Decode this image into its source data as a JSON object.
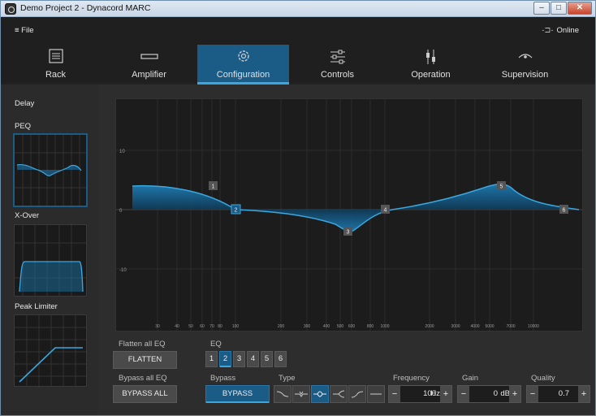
{
  "window": {
    "title": "Demo Project 2 - Dynacord MARC",
    "minimize": "–",
    "maximize": "□",
    "close": "✕"
  },
  "menu": {
    "file": "≡ File",
    "online": "Online"
  },
  "tabs": [
    {
      "label": "Rack",
      "icon": "rack-icon"
    },
    {
      "label": "Amplifier",
      "icon": "amplifier-icon"
    },
    {
      "label": "Configuration",
      "icon": "gear-icon",
      "active": true
    },
    {
      "label": "Controls",
      "icon": "sliders-icon"
    },
    {
      "label": "Operation",
      "icon": "fader-icon"
    },
    {
      "label": "Supervision",
      "icon": "eye-icon"
    }
  ],
  "sidebar": {
    "delay": "Delay",
    "peq": "PEQ",
    "xover": "X-Over",
    "limiter": "Peak Limiter"
  },
  "graph": {
    "y_ticks": [
      "10",
      "0",
      "-10"
    ],
    "x_ticks": [
      "30",
      "40",
      "50",
      "60",
      "70",
      "80",
      "100",
      "200",
      "300",
      "400",
      "500",
      "600",
      "800",
      "1000",
      "2000",
      "3000",
      "4000",
      "5000",
      "7000",
      "10000"
    ],
    "bands": [
      "1",
      "2",
      "3",
      "4",
      "5",
      "6"
    ],
    "accent": "#3aa8e0"
  },
  "controls": {
    "flatten_label": "Flatten all EQ",
    "flatten_button": "FLATTEN",
    "eq_label": "EQ",
    "eq_buttons": [
      "1",
      "2",
      "3",
      "4",
      "5",
      "6"
    ],
    "eq_selected": "2",
    "bypass_all_label": "Bypass all EQ",
    "bypass_all_button": "BYPASS ALL",
    "bypass_label": "Bypass",
    "bypass_button": "BYPASS",
    "type_label": "Type",
    "frequency_label": "Frequency",
    "frequency_value": "100",
    "frequency_unit": "Hz",
    "gain_label": "Gain",
    "gain_value": "0",
    "gain_unit": "dB",
    "quality_label": "Quality",
    "quality_value": "0.7",
    "minus": "−",
    "plus": "+"
  }
}
